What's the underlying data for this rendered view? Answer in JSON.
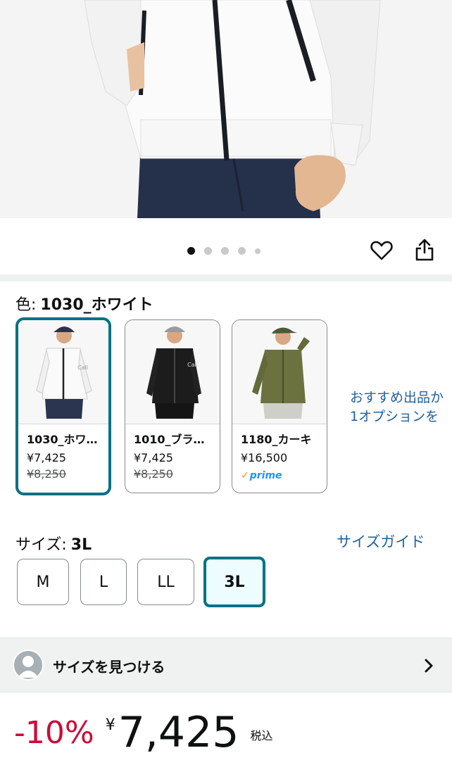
{
  "gallery": {
    "dot_count": 5,
    "active_index": 0
  },
  "color": {
    "label": "色:",
    "selected_value": "1030_ホワイト"
  },
  "swatches": [
    {
      "name": "1030_ホワ…",
      "price": "¥7,425",
      "original_price": "¥8,250",
      "prime": false,
      "selected": true
    },
    {
      "name": "1010_ブラ…",
      "price": "¥7,425",
      "original_price": "¥8,250",
      "prime": false,
      "selected": false
    },
    {
      "name": "1180_カーキ",
      "price": "¥16,500",
      "original_price": "",
      "prime": true,
      "prime_label": "prime",
      "selected": false
    }
  ],
  "recommend": {
    "line1": "おすすめ出品か",
    "line2": "1オプションを"
  },
  "size": {
    "label": "サイズ:",
    "selected_value": "3L",
    "guide_link": "サイズガイド",
    "options": [
      "M",
      "L",
      "LL",
      "3L"
    ]
  },
  "find_size": {
    "label": "サイズを見つける"
  },
  "price": {
    "discount": "-10%",
    "currency": "¥",
    "amount": "7,425",
    "tax_note": "税込"
  },
  "colors": {
    "accent_border": "#007185",
    "link": "#2162a1",
    "discount_red": "#cc0c39",
    "prime_blue": "#1a98ff"
  }
}
